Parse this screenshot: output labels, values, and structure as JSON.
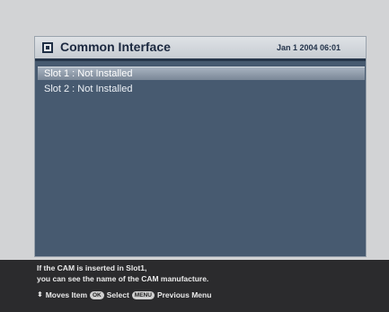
{
  "header": {
    "title": "Common Interface",
    "datetime": "Jan 1 2004 06:01"
  },
  "slots": [
    {
      "label": "Slot 1 : Not Installed",
      "selected": true
    },
    {
      "label": "Slot 2 : Not Installed",
      "selected": false
    }
  ],
  "footer": {
    "help_line_1": "If the CAM is inserted in Slot1,",
    "help_line_2": "you can see the name of the CAM manufacture.",
    "nav_moves": "Moves Item",
    "ok_key": "OK",
    "nav_select": "Select",
    "menu_key": "MENU",
    "nav_previous": "Previous Menu"
  },
  "icons": {
    "header": "common-interface-icon",
    "nav": "up-down-arrows-icon"
  },
  "colors": {
    "panel_bg": "#475a70",
    "header_bg": "#d3d7dc",
    "selection": "#8d99a7",
    "footer_bg": "#2b2b2d",
    "page_bg": "#d2d3d5"
  }
}
